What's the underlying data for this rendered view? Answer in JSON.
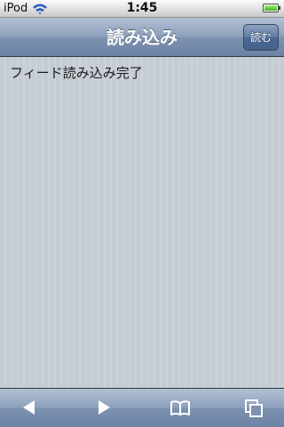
{
  "status_bar": {
    "carrier": "iPod",
    "time": "1:45"
  },
  "nav_bar": {
    "title": "読み込み",
    "right_button_label": "読む"
  },
  "content": {
    "message": "フィード読み込み完了"
  },
  "toolbar": {
    "items": [
      {
        "icon": "back-arrow-icon"
      },
      {
        "icon": "forward-arrow-icon"
      },
      {
        "icon": "bookmarks-icon"
      },
      {
        "icon": "pages-icon"
      }
    ]
  },
  "colors": {
    "nav_bar": "#7d91b0",
    "content_background": "#c5ccd4",
    "battery": "#3fb21c"
  }
}
